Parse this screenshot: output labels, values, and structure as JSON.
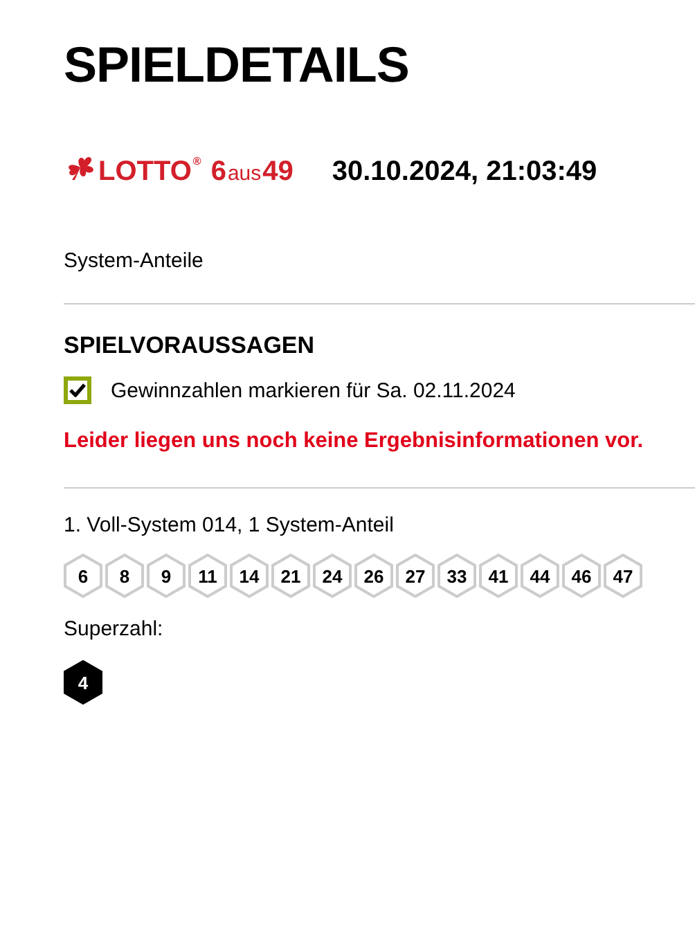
{
  "title": "SPIELDETAILS",
  "logo": {
    "brand": "LOTTO",
    "registered": "®",
    "game_number": "6",
    "game_word": "aus",
    "game_total": "49"
  },
  "timestamp": "30.10.2024, 21:03:49",
  "ticket_type": "System-Anteile",
  "predictions": {
    "heading": "SPIELVORAUSSAGEN",
    "checkbox": {
      "label": "Gewinnzahlen markieren für Sa. 02.11.2024",
      "checked": true
    },
    "notice": "Leider liegen uns noch keine Ergebnisinformationen vor."
  },
  "games": [
    {
      "title": "1. Voll-System 014, 1 System-Anteil",
      "numbers": [
        "6",
        "8",
        "9",
        "11",
        "14",
        "21",
        "24",
        "26",
        "27",
        "33",
        "41",
        "44",
        "46",
        "47"
      ],
      "superzahl_label": "Superzahl:",
      "superzahl": "4"
    }
  ]
}
